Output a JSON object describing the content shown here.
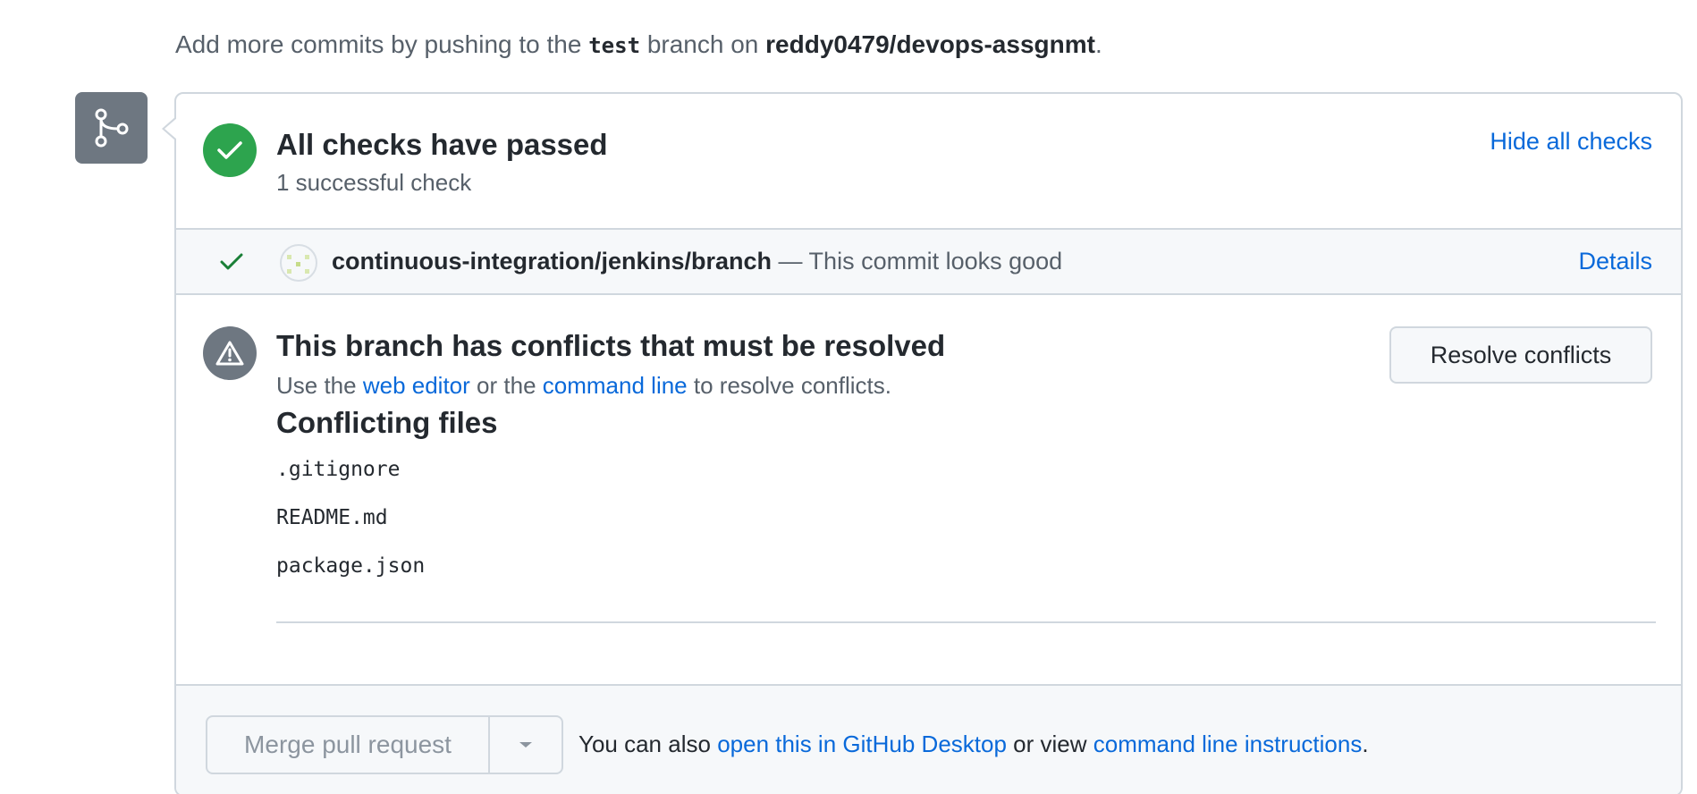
{
  "intro": {
    "prefix": "Add more commits by pushing to the",
    "branch": "test",
    "middle": "branch on",
    "repo": "reddy0479/devops-assgnmt",
    "suffix": "."
  },
  "checks": {
    "title": "All checks have passed",
    "subtitle": "1 successful check",
    "hide_link": "Hide all checks",
    "rows": [
      {
        "context": "continuous-integration/jenkins/branch",
        "description": "— This commit looks good",
        "details_link": "Details"
      }
    ]
  },
  "conflicts": {
    "title": "This branch has conflicts that must be resolved",
    "sub_prefix": "Use the",
    "web_editor_link": "web editor",
    "sub_middle": "or the",
    "command_line_link": "command line",
    "sub_suffix": "to resolve conflicts.",
    "resolve_button": "Resolve conflicts",
    "files_heading": "Conflicting files",
    "files": [
      ".gitignore",
      "README.md",
      "package.json"
    ]
  },
  "merge": {
    "button_label": "Merge pull request",
    "note_prefix": "You can also",
    "desktop_link": "open this in GitHub Desktop",
    "note_middle": "or view",
    "instructions_link": "command line instructions",
    "note_suffix": "."
  },
  "colors": {
    "success": "#2da44e",
    "link": "#0969da",
    "neutral": "#6e7781"
  }
}
